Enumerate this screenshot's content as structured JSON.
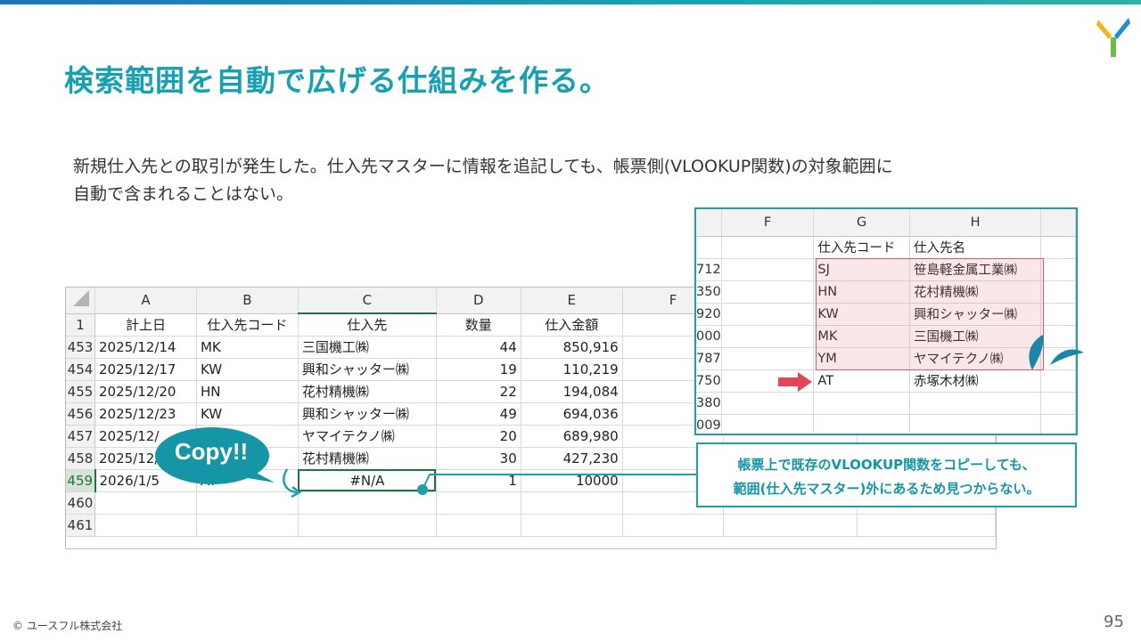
{
  "slide": {
    "title": "検索範囲を自動で広げる仕組みを作る。",
    "description_line1": "新規仕入先との取引が発生した。仕入先マスターに情報を追記しても、帳票側(VLOOKUP関数)の対象範囲に",
    "description_line2": "自動で含まれることはない。",
    "copy_bubble": "Copy!!",
    "note_line1": "帳票上で既存のVLOOKUP関数をコピーしても、",
    "note_line2": "範囲(仕入先マスター)外にあるため見つからない。",
    "footer_copyright": "© ユースフル株式会社",
    "page_number": "95"
  },
  "main_sheet": {
    "columns": [
      "A",
      "B",
      "C",
      "D",
      "E",
      "F"
    ],
    "header_row": {
      "row": "1",
      "cells": [
        "計上日",
        "仕入先コード",
        "仕入先",
        "数量",
        "仕入金額",
        ""
      ]
    },
    "rows": [
      {
        "row": "453",
        "date": "2025/12/14",
        "code": "MK",
        "supplier": "三国機工㈱",
        "qty": "44",
        "amount": "850,916"
      },
      {
        "row": "454",
        "date": "2025/12/17",
        "code": "KW",
        "supplier": "興和シャッター㈱",
        "qty": "19",
        "amount": "110,219"
      },
      {
        "row": "455",
        "date": "2025/12/20",
        "code": "HN",
        "supplier": "花村精機㈱",
        "qty": "22",
        "amount": "194,084"
      },
      {
        "row": "456",
        "date": "2025/12/23",
        "code": "KW",
        "supplier": "興和シャッター㈱",
        "qty": "49",
        "amount": "694,036"
      },
      {
        "row": "457",
        "date": "2025/12/",
        "code": "",
        "supplier": "ヤマイテクノ㈱",
        "qty": "20",
        "amount": "689,980"
      },
      {
        "row": "458",
        "date": "2025/12/2",
        "code": "",
        "supplier": "花村精機㈱",
        "qty": "30",
        "amount": "427,230"
      },
      {
        "row": "459",
        "date": "2026/1/5",
        "code": "AT",
        "supplier": "#N/A",
        "qty": "1",
        "amount": "10000"
      },
      {
        "row": "460",
        "date": "",
        "code": "",
        "supplier": "",
        "qty": "",
        "amount": ""
      },
      {
        "row": "461",
        "date": "",
        "code": "",
        "supplier": "",
        "qty": "",
        "amount": ""
      }
    ]
  },
  "master_sheet": {
    "columns": [
      "F",
      "G",
      "H"
    ],
    "header_row": {
      "row": "",
      "g": "仕入先コード",
      "h": "仕入先名"
    },
    "rows": [
      {
        "row": "712",
        "g": "SJ",
        "h": "笹島軽金属工業㈱"
      },
      {
        "row": "350",
        "g": "HN",
        "h": "花村精機㈱"
      },
      {
        "row": "920",
        "g": "KW",
        "h": "興和シャッター㈱"
      },
      {
        "row": "000",
        "g": "MK",
        "h": "三国機工㈱"
      },
      {
        "row": "787",
        "g": "YM",
        "h": "ヤマイテクノ㈱"
      },
      {
        "row": "750",
        "g": "AT",
        "h": "赤塚木材㈱"
      },
      {
        "row": "380",
        "g": "",
        "h": ""
      },
      {
        "row": "009",
        "g": "",
        "h": ""
      }
    ]
  },
  "colors": {
    "accent": "#16a0b0",
    "excel_green": "#217346",
    "highlight_red": "#e0475a",
    "bubble": "#1496a6"
  }
}
